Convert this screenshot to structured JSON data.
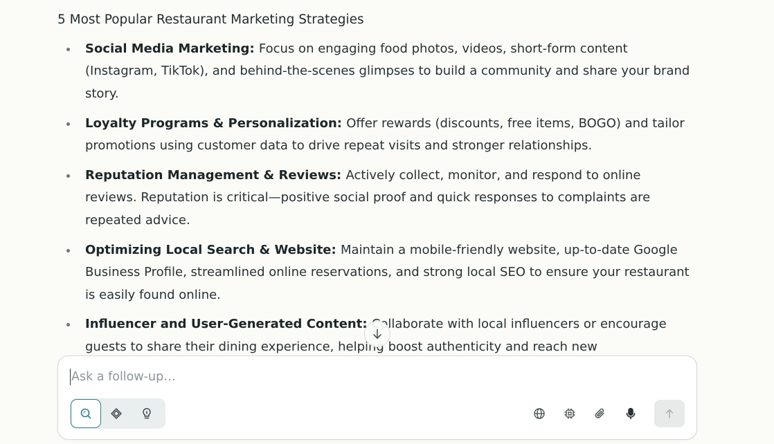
{
  "answer": {
    "heading": "5 Most Popular Restaurant Marketing Strategies",
    "strategies": [
      {
        "title": "Social Media Marketing:",
        "body": "Focus on engaging food photos, videos, short-form content (Instagram, TikTok), and behind-the-scenes glimpses to build a community and share your brand story."
      },
      {
        "title": "Loyalty Programs & Personalization:",
        "body": "Offer rewards (discounts, free items, BOGO) and tailor promotions using customer data to drive repeat visits and stronger relationships."
      },
      {
        "title": "Reputation Management & Reviews:",
        "body": "Actively collect, monitor, and respond to online reviews. Reputation is critical—positive social proof and quick responses to complaints are repeated advice."
      },
      {
        "title": "Optimizing Local Search & Website:",
        "body": "Maintain a mobile-friendly website, up-to-date Google Business Profile, streamlined online reservations, and strong local SEO to ensure your restaurant is easily found online."
      },
      {
        "title": "Influencer and User-Generated Content:",
        "body": "Collaborate with local influencers or encourage guests to share their dining experience, helping boost authenticity and reach new"
      }
    ]
  },
  "composer": {
    "placeholder": "Ask a follow-up…",
    "modes": [
      {
        "name": "search",
        "icon": "search-icon",
        "active": true
      },
      {
        "name": "research",
        "icon": "research-icon",
        "active": false
      },
      {
        "name": "labs",
        "icon": "lightbulb-icon",
        "active": false
      }
    ],
    "tools": [
      "globe-icon",
      "chip-icon",
      "paperclip-icon",
      "microphone-icon"
    ],
    "send_icon": "arrow-up-icon"
  },
  "colors": {
    "accent": "#2e7f8a",
    "background": "#fbfbf8",
    "text": "#1f2a2c"
  }
}
